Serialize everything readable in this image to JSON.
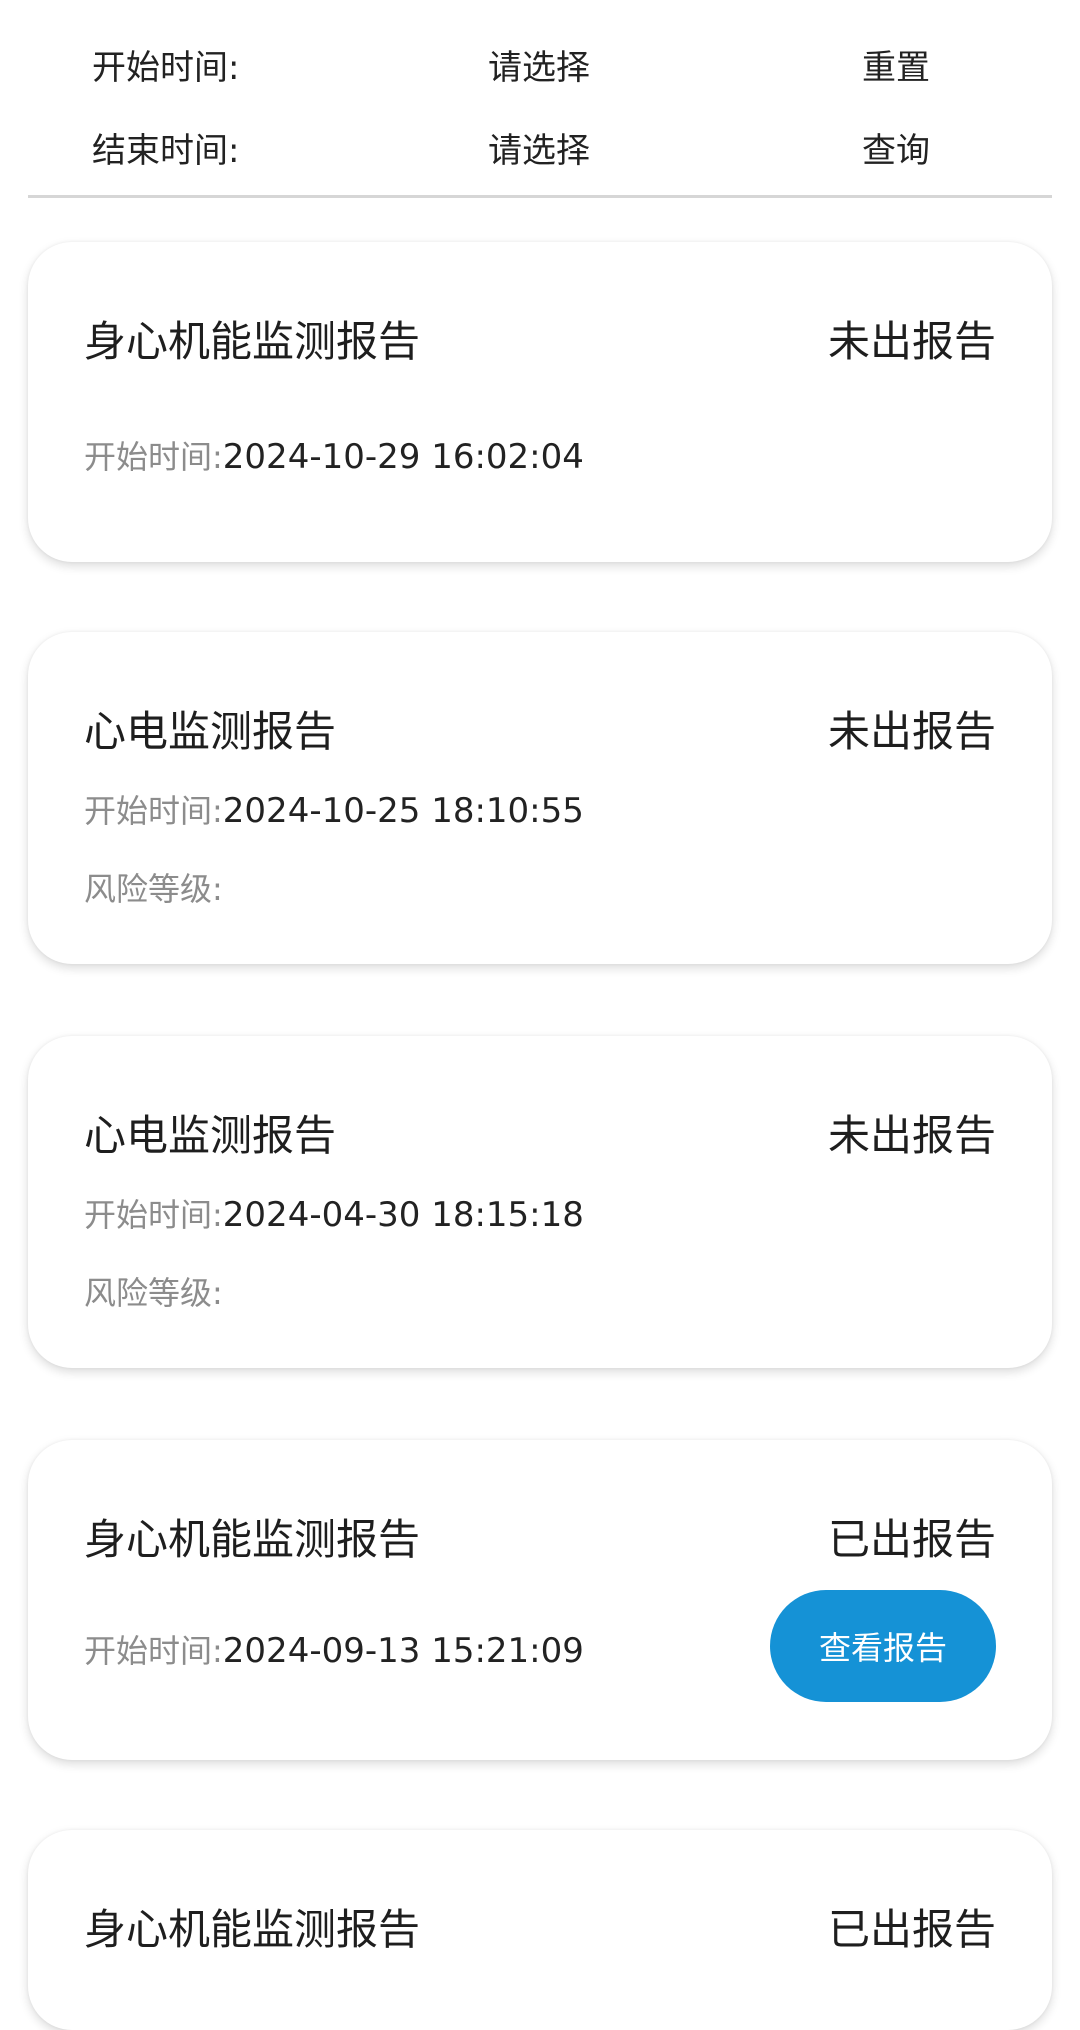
{
  "filter": {
    "start_label": "开始时间:",
    "start_placeholder": "请选择",
    "reset_label": "重置",
    "end_label": "结束时间:",
    "end_placeholder": "请选择",
    "query_label": "查询"
  },
  "reports": [
    {
      "title": "身心机能监测报告",
      "status": "未出报告",
      "start_label": "开始时间:",
      "start_time": "2024-10-29 16:02:04"
    },
    {
      "title": "心电监测报告",
      "status": "未出报告",
      "start_label": "开始时间:",
      "start_time": "2024-10-25 18:10:55",
      "risk_label": "风险等级:"
    },
    {
      "title": "心电监测报告",
      "status": "未出报告",
      "start_label": "开始时间:",
      "start_time": "2024-04-30 18:15:18",
      "risk_label": "风险等级:"
    },
    {
      "title": "身心机能监测报告",
      "status": "已出报告",
      "start_label": "开始时间:",
      "start_time": "2024-09-13 15:21:09",
      "view_button": "查看报告"
    },
    {
      "title": "身心机能监测报告",
      "status": "已出报告"
    }
  ],
  "colors": {
    "accent": "#1592d6",
    "label_gray": "#8c8c8c",
    "divider": "#d6d6d6"
  }
}
